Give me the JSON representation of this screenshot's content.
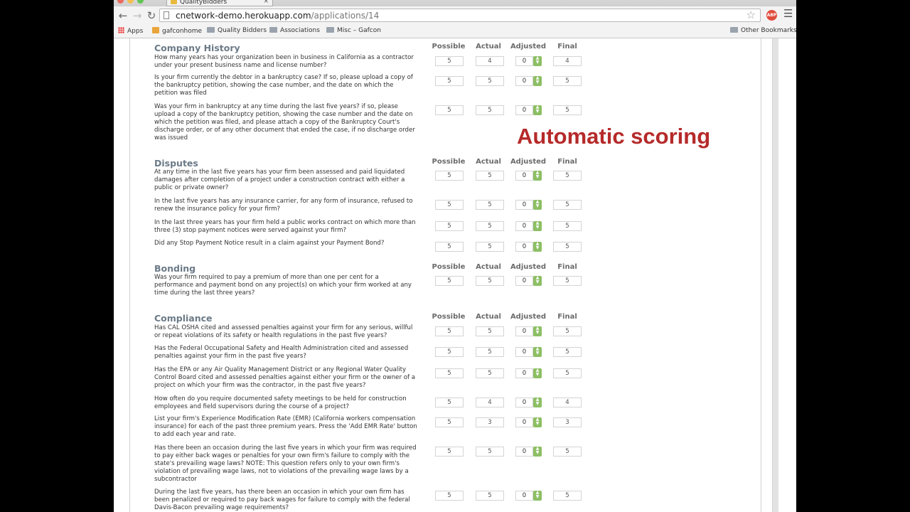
{
  "browser": {
    "tab_title": "QualityBidders",
    "tab_close": "×",
    "url_host": "cnetwork-demo.herokuapp.com",
    "url_path": "/applications/14",
    "ext_label": "ABP",
    "bookmarks": [
      "Apps",
      "gafconhome",
      "Quality Bidders",
      "Associations",
      "Misc – Gafcon"
    ],
    "other_bookmarks": "Other Bookmarks"
  },
  "overlay_text": "Automatic scoring",
  "columns": [
    "Possible",
    "Actual",
    "Adjusted",
    "Final"
  ],
  "sections": [
    {
      "title": "Company History",
      "questions": [
        {
          "text": "How many years has your organization been in business in California as a contractor under your present business name and license number?",
          "possible": "5",
          "actual": "4",
          "adjusted": "0",
          "final": "4"
        },
        {
          "text": "Is your firm currently the debtor in a bankruptcy case? If so, please upload a copy of the bankruptcy petition, showing the case number, and the date on which the petition was filed",
          "possible": "5",
          "actual": "5",
          "adjusted": "0",
          "final": "5"
        },
        {
          "text": "Was your firm in bankruptcy at any time during the last five years? if so, please upload a copy of the bankruptcy petition, showing the case number and the date on which the petition was filed, and please attach a copy of the Bankruptcy Court's discharge order, or of any other document that ended the case, if no discharge order was issued",
          "possible": "5",
          "actual": "5",
          "adjusted": "0",
          "final": "5"
        }
      ]
    },
    {
      "title": "Disputes",
      "questions": [
        {
          "text": "At any time in the last five years has your firm been assessed and paid liquidated damages after completion of a project under a construction contract with either a public or private owner?",
          "possible": "5",
          "actual": "5",
          "adjusted": "0",
          "final": "5"
        },
        {
          "text": "In the last five years has any insurance carrier, for any form of insurance, refused to renew the insurance policy for your firm?",
          "possible": "5",
          "actual": "5",
          "adjusted": "0",
          "final": "5"
        },
        {
          "text": "In the last three years has your firm held a public works contract on which more than three (3) stop payment notices were served against your firm?",
          "possible": "5",
          "actual": "5",
          "adjusted": "0",
          "final": "5"
        },
        {
          "text": "Did any Stop Payment Notice result in a claim against your Payment Bond?",
          "possible": "5",
          "actual": "5",
          "adjusted": "0",
          "final": "5"
        }
      ]
    },
    {
      "title": "Bonding",
      "questions": [
        {
          "text": "Was your firm required to pay a premium of more than one per cent for a performance and payment bond on any project(s) on which your firm worked at any time during the last three years?",
          "possible": "5",
          "actual": "5",
          "adjusted": "0",
          "final": "5"
        }
      ]
    },
    {
      "title": "Compliance",
      "questions": [
        {
          "text": "Has CAL OSHA cited and assessed penalties against your firm for any serious, willful or repeat violations of its safety or health regulations in the past five years?",
          "possible": "5",
          "actual": "5",
          "adjusted": "0",
          "final": "5"
        },
        {
          "text": "Has the Federal Occupational Safety and Health Administration cited and assessed penalties against your firm in the past five years?",
          "possible": "5",
          "actual": "5",
          "adjusted": "0",
          "final": "5"
        },
        {
          "text": "Has the EPA or any Air Quality Management District or any Regional Water Quality Control Board cited and assessed penalties against either your firm or the owner of a project on which your firm was the contractor, in the past five years?",
          "possible": "5",
          "actual": "5",
          "adjusted": "0",
          "final": "5"
        },
        {
          "text": "How often do you require documented safety meetings to be held for construction employees and field supervisors during the course of a project?",
          "possible": "5",
          "actual": "4",
          "adjusted": "0",
          "final": "4"
        },
        {
          "text": "List your firm's Experience Modification Rate (EMR) (California workers compensation insurance) for each of the past three premium years. Press the 'Add EMR Rate' button to add each year and rate.",
          "possible": "5",
          "actual": "3",
          "adjusted": "0",
          "final": "3"
        },
        {
          "text": "Has there been an occasion during the last five years in which your firm was required to pay either back wages or penalties for your own firm's failure to comply with the state's prevailing wage laws? NOTE: This question refers only to your own firm's violation of prevailing wage laws, not to violations of the prevailing wage laws by a subcontractor",
          "possible": "5",
          "actual": "5",
          "adjusted": "0",
          "final": "5"
        },
        {
          "text": "During the last five years, has there been an occasion in which your own firm has been penalized or required to pay back wages for failure to comply with the federal Davis-Bacon prevailing wage requirements?",
          "possible": "5",
          "actual": "5",
          "adjusted": "0",
          "final": "5"
        }
      ]
    }
  ]
}
